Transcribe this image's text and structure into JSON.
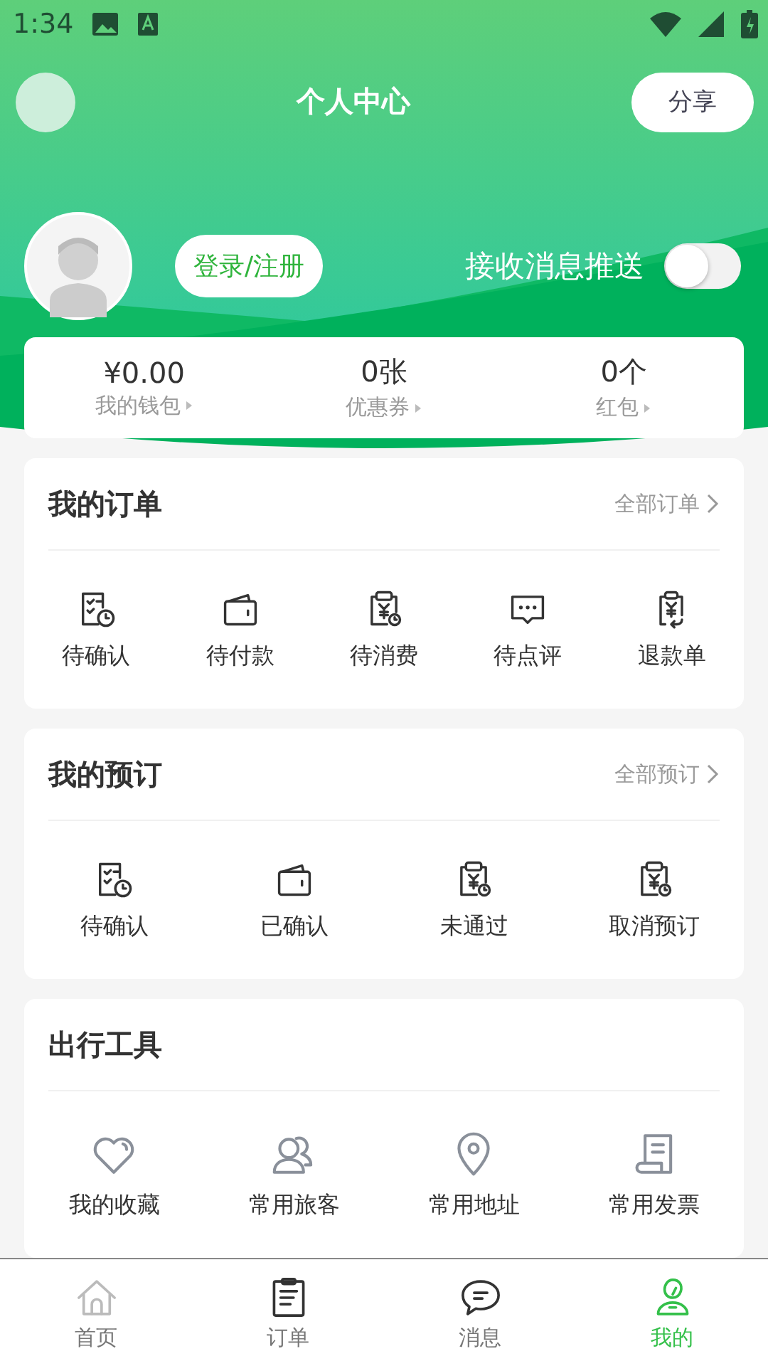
{
  "status_bar": {
    "time": "1:34"
  },
  "header": {
    "title": "个人中心",
    "share_button": "分享"
  },
  "profile": {
    "login_button": "登录/注册",
    "push_label": "接收消息推送",
    "push_on": false
  },
  "wallet": [
    {
      "value": "¥0.00",
      "label": "我的钱包"
    },
    {
      "value": "0张",
      "label": "优惠券"
    },
    {
      "value": "0个",
      "label": "红包"
    }
  ],
  "orders": {
    "title": "我的订单",
    "link": "全部订单",
    "items": [
      {
        "label": "待确认",
        "kind": "checklist"
      },
      {
        "label": "待付款",
        "kind": "wallet"
      },
      {
        "label": "待消费",
        "kind": "clipboard"
      },
      {
        "label": "待点评",
        "kind": "chat"
      },
      {
        "label": "退款单",
        "kind": "refund"
      }
    ]
  },
  "bookings": {
    "title": "我的预订",
    "link": "全部预订",
    "items": [
      {
        "label": "待确认",
        "kind": "checklist"
      },
      {
        "label": "已确认",
        "kind": "wallet"
      },
      {
        "label": "未通过",
        "kind": "clipboard"
      },
      {
        "label": "取消预订",
        "kind": "clipboard"
      }
    ]
  },
  "tools": {
    "title": "出行工具",
    "items": [
      {
        "label": "我的收藏",
        "kind": "heart"
      },
      {
        "label": "常用旅客",
        "kind": "people"
      },
      {
        "label": "常用地址",
        "kind": "pin"
      },
      {
        "label": "常用发票",
        "kind": "receipt"
      }
    ]
  },
  "tabs": [
    {
      "label": "首页",
      "kind": "home",
      "selected": false
    },
    {
      "label": "订单",
      "kind": "orders",
      "selected": false
    },
    {
      "label": "消息",
      "kind": "message",
      "selected": false
    },
    {
      "label": "我的",
      "kind": "me",
      "selected": true
    }
  ]
}
